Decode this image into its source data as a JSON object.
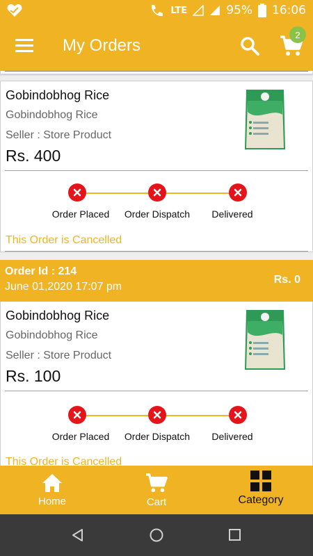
{
  "status_bar": {
    "signal_label": "LTE",
    "battery_percent": "95%",
    "time": "16:06"
  },
  "app_bar": {
    "title": "My Orders",
    "cart_badge_count": "2"
  },
  "orders": [
    {
      "product_name": "Gobindobhog Rice",
      "product_desc": "Gobindobhog Rice",
      "seller": "Seller : Store Product",
      "price": "Rs. 400",
      "steps": [
        "Order Placed",
        "Order Dispatch",
        "Delivered"
      ],
      "status_text": "This Order is Cancelled"
    },
    {
      "order_id": "Order Id : 214",
      "date": "June 01,2020 17:07 pm",
      "total": "Rs. 0",
      "product_name": "Gobindobhog Rice",
      "product_desc": "Gobindobhog Rice",
      "seller": "Seller : Store Product",
      "price": "Rs. 100",
      "steps": [
        "Order Placed",
        "Order Dispatch",
        "Delivered"
      ],
      "status_text": "This Order is Cancelled"
    }
  ],
  "bottom_nav": {
    "home": "Home",
    "cart": "Cart",
    "category": "Category"
  },
  "colors": {
    "accent": "#f0b323",
    "cancel_red": "#e5141b",
    "badge_green": "#8bc34a"
  }
}
